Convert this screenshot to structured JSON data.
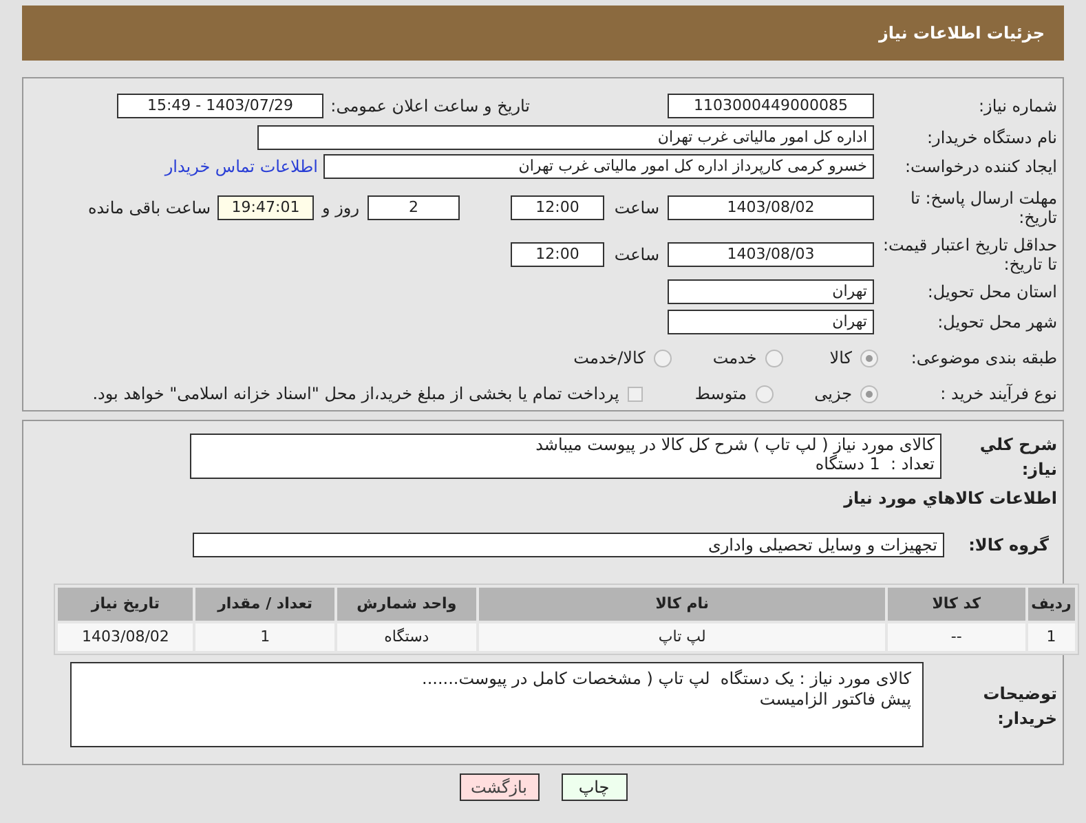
{
  "header": {
    "title": "جزئیات اطلاعات نیاز"
  },
  "need_number": {
    "label": "شماره نیاز:",
    "value": "1103000449000085"
  },
  "announce": {
    "label": "تاریخ و ساعت اعلان عمومی:",
    "value": "1403/07/29 - 15:49"
  },
  "buyer_org": {
    "label": "نام دستگاه خریدار:",
    "value": "اداره کل امور مالیاتی غرب تهران"
  },
  "requester": {
    "label": "ایجاد کننده درخواست:",
    "value": "خسرو کرمی کارپرداز اداره کل امور مالیاتی غرب تهران",
    "link": "اطلاعات تماس خریدار"
  },
  "response_deadline": {
    "label": "مهلت ارسال پاسخ: تا تاریخ:",
    "date": "1403/08/02",
    "time_label": "ساعت",
    "time": "12:00",
    "days": "2",
    "days_label": "روز و",
    "remaining": "19:47:01",
    "remaining_label": "ساعت باقی مانده"
  },
  "price_validity": {
    "label": "حداقل تاریخ اعتبار قیمت: تا تاریخ:",
    "date": "1403/08/03",
    "time_label": "ساعت",
    "time": "12:00"
  },
  "province": {
    "label": "استان محل تحویل:",
    "value": "تهران"
  },
  "city": {
    "label": "شهر محل تحویل:",
    "value": "تهران"
  },
  "category": {
    "label": "طبقه بندی موضوعی:",
    "options": [
      {
        "label": "کالا",
        "selected": true
      },
      {
        "label": "خدمت",
        "selected": false
      },
      {
        "label": "کالا/خدمت",
        "selected": false
      }
    ]
  },
  "process": {
    "label": "نوع فرآیند خرید :",
    "options": [
      {
        "label": "جزیی",
        "selected": true
      },
      {
        "label": "متوسط",
        "selected": false
      }
    ],
    "payment": {
      "label": "پرداخت تمام یا بخشی از مبلغ خرید،از محل \"اسناد خزانه اسلامی\" خواهد بود.",
      "checked": false
    }
  },
  "description": {
    "label": "شرح کلي نياز:",
    "lines": [
      "کالای مورد نیاز ( لپ تاپ ) شرح کل کالا در پیوست میباشد",
      "تعداد :  1 دستگاه"
    ]
  },
  "goods_heading": "اطلاعات کالاهاي مورد نياز",
  "goods_group": {
    "label": "گروه کالا:",
    "value": "تجهیزات و وسایل تحصیلی واداری"
  },
  "table": {
    "columns": [
      "ردیف",
      "کد کالا",
      "نام کالا",
      "واحد شمارش",
      "تعداد / مقدار",
      "تاریخ نیاز"
    ],
    "rows": [
      [
        "1",
        "--",
        "لپ تاپ",
        "دستگاه",
        "1",
        "1403/08/02"
      ]
    ]
  },
  "buyer_notes": {
    "label": "توضیحات خریدار:",
    "lines": [
      "کالای مورد نیاز : یک دستگاه  لپ تاپ ( مشخصات کامل در پیوست.......",
      "پیش فاکتور الزامیست"
    ]
  },
  "buttons": [
    {
      "label": "چاپ",
      "kind": "print"
    },
    {
      "label": "بازگشت",
      "kind": "back"
    }
  ]
}
